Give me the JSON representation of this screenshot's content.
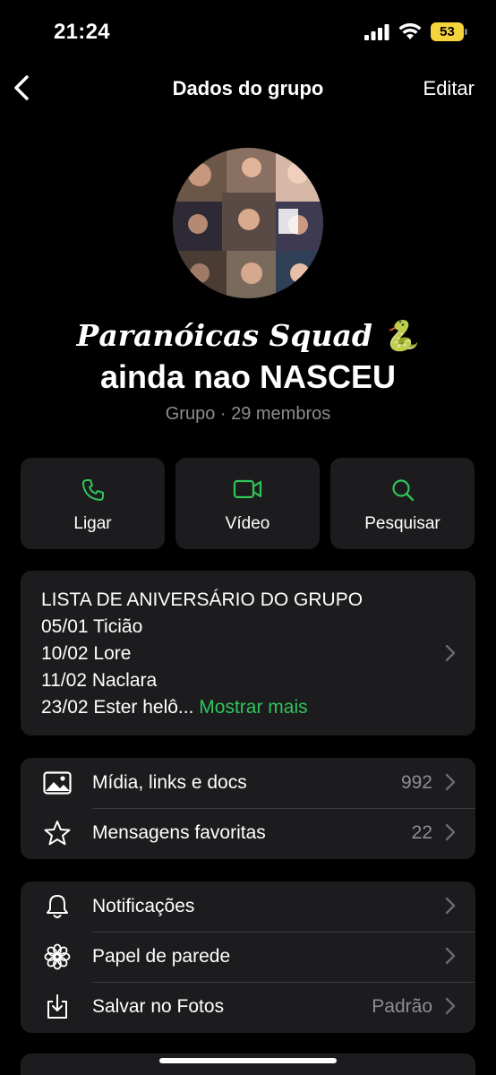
{
  "status_bar": {
    "time": "21:24",
    "battery": "53"
  },
  "nav": {
    "title": "Dados do grupo",
    "edit_label": "Editar"
  },
  "group": {
    "name_line1": "𝑷𝒂𝒓𝒂𝒏𝒐́𝒊𝒄𝒂𝒔 𝑺𝒒𝒖𝒂𝒅 🐍",
    "name_line2": "ainda nao NASCEU",
    "meta": "Grupo · 29 membros"
  },
  "actions": [
    {
      "label": "Ligar",
      "icon": "phone-icon"
    },
    {
      "label": "Vídeo",
      "icon": "video-icon"
    },
    {
      "label": "Pesquisar",
      "icon": "search-icon"
    }
  ],
  "description": {
    "lines": [
      "LISTA DE ANIVERSÁRIO DO GRUPO",
      "05/01 Ticião",
      "10/02 Lore",
      "11/02  Naclara",
      "23/02 Ester helô..."
    ],
    "show_more": "Mostrar mais"
  },
  "media_group": [
    {
      "label": "Mídia, links e docs",
      "value": "992",
      "icon": "image-icon"
    },
    {
      "label": "Mensagens favoritas",
      "value": "22",
      "icon": "star-icon"
    }
  ],
  "settings_group": [
    {
      "label": "Notificações",
      "value": "",
      "icon": "bell-icon"
    },
    {
      "label": "Papel de parede",
      "value": "",
      "icon": "flower-icon"
    },
    {
      "label": "Salvar no Fotos",
      "value": "Padrão",
      "icon": "download-icon"
    }
  ],
  "colors": {
    "accent": "#30c45a",
    "card": "#1c1c1e",
    "secondary_text": "#8d8d92"
  }
}
